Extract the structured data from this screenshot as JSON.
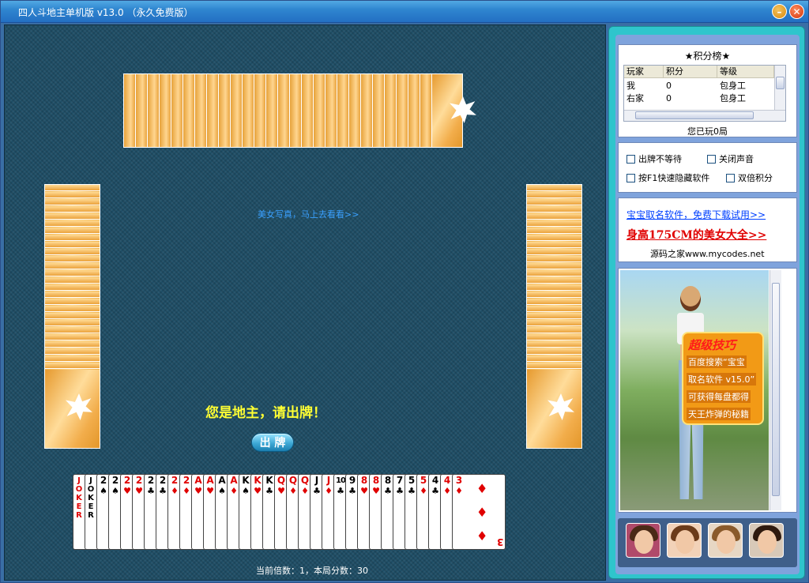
{
  "window": {
    "title": "四人斗地主单机版 v13.0  （永久免费版）",
    "min_glyph": "–",
    "close_glyph": "✕"
  },
  "board": {
    "promo_link": "美女写真，马上去看看>>",
    "prompt": "您是地主，请出牌！",
    "play_button": "出 牌",
    "status": "当前倍数：1，本局分数：30"
  },
  "hand": [
    {
      "rank": "JOKER",
      "suit": "",
      "color": "red",
      "joker": true
    },
    {
      "rank": "JOKER",
      "suit": "",
      "color": "black",
      "joker": true
    },
    {
      "rank": "2",
      "suit": "♠",
      "color": "black"
    },
    {
      "rank": "2",
      "suit": "♠",
      "color": "black"
    },
    {
      "rank": "2",
      "suit": "♥",
      "color": "red"
    },
    {
      "rank": "2",
      "suit": "♥",
      "color": "red"
    },
    {
      "rank": "2",
      "suit": "♣",
      "color": "black"
    },
    {
      "rank": "2",
      "suit": "♣",
      "color": "black"
    },
    {
      "rank": "2",
      "suit": "♦",
      "color": "red"
    },
    {
      "rank": "2",
      "suit": "♦",
      "color": "red"
    },
    {
      "rank": "A",
      "suit": "♥",
      "color": "red"
    },
    {
      "rank": "A",
      "suit": "♥",
      "color": "red"
    },
    {
      "rank": "A",
      "suit": "♠",
      "color": "black"
    },
    {
      "rank": "A",
      "suit": "♦",
      "color": "red"
    },
    {
      "rank": "K",
      "suit": "♠",
      "color": "black"
    },
    {
      "rank": "K",
      "suit": "♥",
      "color": "red"
    },
    {
      "rank": "K",
      "suit": "♣",
      "color": "black"
    },
    {
      "rank": "Q",
      "suit": "♥",
      "color": "red"
    },
    {
      "rank": "Q",
      "suit": "♦",
      "color": "red"
    },
    {
      "rank": "Q",
      "suit": "♦",
      "color": "red"
    },
    {
      "rank": "J",
      "suit": "♣",
      "color": "black"
    },
    {
      "rank": "J",
      "suit": "♦",
      "color": "red"
    },
    {
      "rank": "10",
      "suit": "♣",
      "color": "black"
    },
    {
      "rank": "9",
      "suit": "♣",
      "color": "black"
    },
    {
      "rank": "8",
      "suit": "♥",
      "color": "red"
    },
    {
      "rank": "8",
      "suit": "♥",
      "color": "red"
    },
    {
      "rank": "8",
      "suit": "♣",
      "color": "black"
    },
    {
      "rank": "7",
      "suit": "♣",
      "color": "black"
    },
    {
      "rank": "5",
      "suit": "♣",
      "color": "black"
    },
    {
      "rank": "5",
      "suit": "♦",
      "color": "red"
    },
    {
      "rank": "4",
      "suit": "♣",
      "color": "black"
    },
    {
      "rank": "4",
      "suit": "♦",
      "color": "red"
    },
    {
      "rank": "3",
      "suit": "♦",
      "color": "red"
    }
  ],
  "opponents": {
    "top_cards": 27,
    "left_cards": 27,
    "right_cards": 27
  },
  "score_panel": {
    "title": "★积分榜★",
    "headers": [
      "玩家",
      "积分",
      "等级"
    ],
    "rows": [
      [
        "我",
        "0",
        "包身工"
      ],
      [
        "右家",
        "0",
        "包身工"
      ]
    ],
    "played": "您已玩0局"
  },
  "options": {
    "no_wait": "出牌不等待",
    "mute": "关闭声音",
    "hide_f1": "按F1快速隐藏软件",
    "double_score": "双倍积分"
  },
  "ads": {
    "ad1": "宝宝取名软件，免费下载试用>>",
    "ad2": "身高175CM的美女大全>>",
    "ad3": "源码之家www.mycodes.net"
  },
  "photo_promo": {
    "title": "超级技巧",
    "lines": [
      "百度搜索“宝宝",
      "取名软件 v15.0”",
      "可获得每盘都得",
      "天王炸弹的秘籍"
    ]
  },
  "colors": {
    "board": "#1f4e66",
    "prompt": "#ffff33",
    "panel": "#2fc5cc",
    "link": "#0040ff"
  }
}
